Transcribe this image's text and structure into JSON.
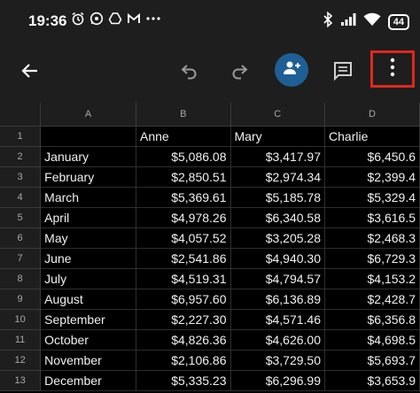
{
  "status_bar": {
    "time": "19:36",
    "battery": "44",
    "icons": [
      "alarm-icon",
      "whatsapp-icon",
      "drive-icon",
      "gmail-icon",
      "more-notifications-icon",
      "bluetooth-icon",
      "signal-icon",
      "wifi-icon"
    ]
  },
  "toolbar": {
    "buttons": [
      "back-arrow-icon",
      "undo-icon",
      "redo-icon",
      "add-person-icon",
      "comments-icon",
      "more-vertical-icon"
    ],
    "accent_color": "#1e5f95",
    "highlight_color": "#e0271a"
  },
  "sheet": {
    "columns": [
      "A",
      "B",
      "C",
      "D"
    ],
    "rows": [
      {
        "num": "1",
        "cells": [
          "",
          "Anne",
          "Mary",
          "Charlie"
        ]
      },
      {
        "num": "2",
        "cells": [
          "January",
          "$5,086.08",
          "$3,417.97",
          "$6,450.6"
        ]
      },
      {
        "num": "3",
        "cells": [
          "February",
          "$2,850.51",
          "$2,974.34",
          "$2,399.4"
        ]
      },
      {
        "num": "4",
        "cells": [
          "March",
          "$5,369.61",
          "$5,185.78",
          "$5,329.4"
        ]
      },
      {
        "num": "5",
        "cells": [
          "April",
          "$4,978.26",
          "$6,340.58",
          "$3,616.5"
        ]
      },
      {
        "num": "6",
        "cells": [
          "May",
          "$4,057.52",
          "$3,205.28",
          "$2,468.3"
        ]
      },
      {
        "num": "7",
        "cells": [
          "June",
          "$2,541.86",
          "$4,940.30",
          "$6,729.3"
        ]
      },
      {
        "num": "8",
        "cells": [
          "July",
          "$4,519.31",
          "$4,794.57",
          "$4,153.2"
        ]
      },
      {
        "num": "9",
        "cells": [
          "August",
          "$6,957.60",
          "$6,136.89",
          "$2,428.7"
        ]
      },
      {
        "num": "10",
        "cells": [
          "September",
          "$2,227.30",
          "$4,571.46",
          "$6,356.8"
        ]
      },
      {
        "num": "11",
        "cells": [
          "October",
          "$4,826.36",
          "$4,626.00",
          "$4,698.5"
        ]
      },
      {
        "num": "12",
        "cells": [
          "November",
          "$2,106.86",
          "$3,729.50",
          "$5,693.7"
        ]
      },
      {
        "num": "13",
        "cells": [
          "December",
          "$5,335.23",
          "$6,296.99",
          "$3,653.9"
        ]
      }
    ]
  }
}
